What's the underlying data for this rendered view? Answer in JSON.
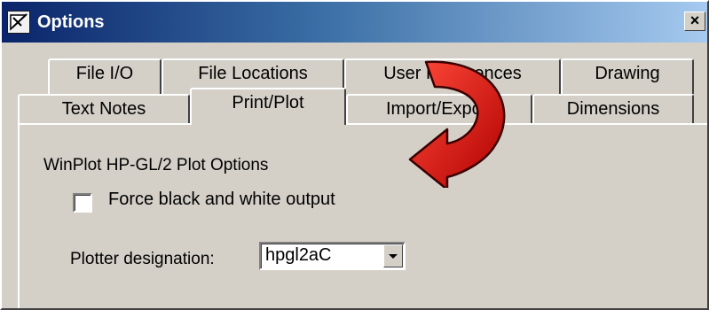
{
  "window": {
    "title": "Options",
    "close_glyph": "×"
  },
  "tabs_back_row": [
    {
      "label": "File I/O"
    },
    {
      "label": "File Locations"
    },
    {
      "label": "User Preferences"
    },
    {
      "label": "Drawing"
    }
  ],
  "tabs_front_row": [
    {
      "label": "Text Notes"
    },
    {
      "label": "Print/Plot",
      "active": true
    },
    {
      "label": "Import/Export"
    },
    {
      "label": "Dimensions"
    }
  ],
  "panel": {
    "group_label": "WinPlot HP-GL/2 Plot Options",
    "force_bw": {
      "label": "Force black and white output",
      "checked": false
    },
    "plotter": {
      "label": "Plotter designation:",
      "value": "hpgl2aC"
    }
  },
  "annotation": {
    "arrow_icon": "curved-arrow-icon",
    "arrow_color": "#e01010"
  },
  "colors": {
    "titlebar_start": "#0a246a",
    "titlebar_end": "#a6caf0",
    "face": "#d4d0c8"
  }
}
